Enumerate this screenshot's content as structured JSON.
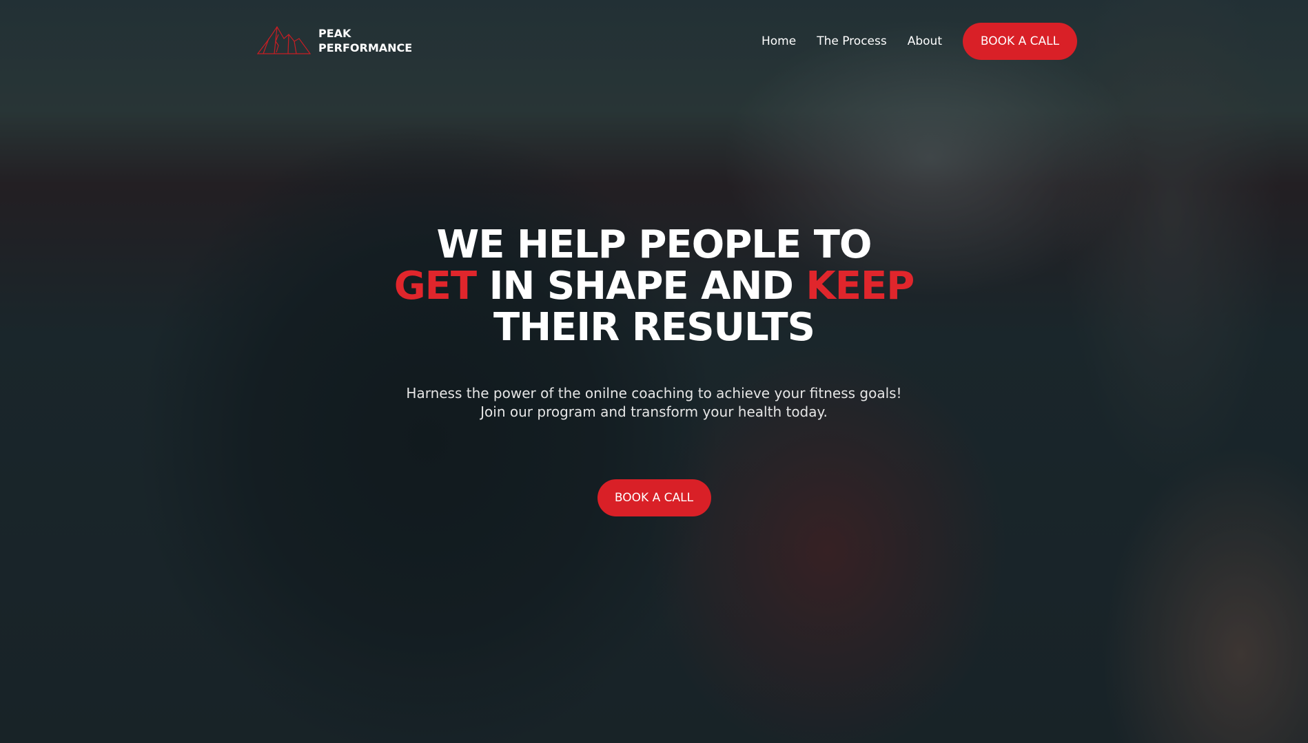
{
  "brand": {
    "name_line1": "PEAK",
    "name_line2": "PERFORMANCE",
    "accent": "#d92027"
  },
  "nav": {
    "items": [
      {
        "label": "Home"
      },
      {
        "label": "The Process"
      },
      {
        "label": "About"
      }
    ],
    "cta_label": "BOOK A CALL"
  },
  "hero": {
    "headline": {
      "p1": "WE HELP PEOPLE TO ",
      "h1": "GET",
      "p2": " IN SHAPE AND ",
      "h2": "KEEP",
      "p3": " THEIR RESULTS"
    },
    "subtitle": "Harness the power of the onilne coaching to achieve your fitness goals! Join our program and transform your health today.",
    "cta_label": "BOOK A CALL"
  }
}
